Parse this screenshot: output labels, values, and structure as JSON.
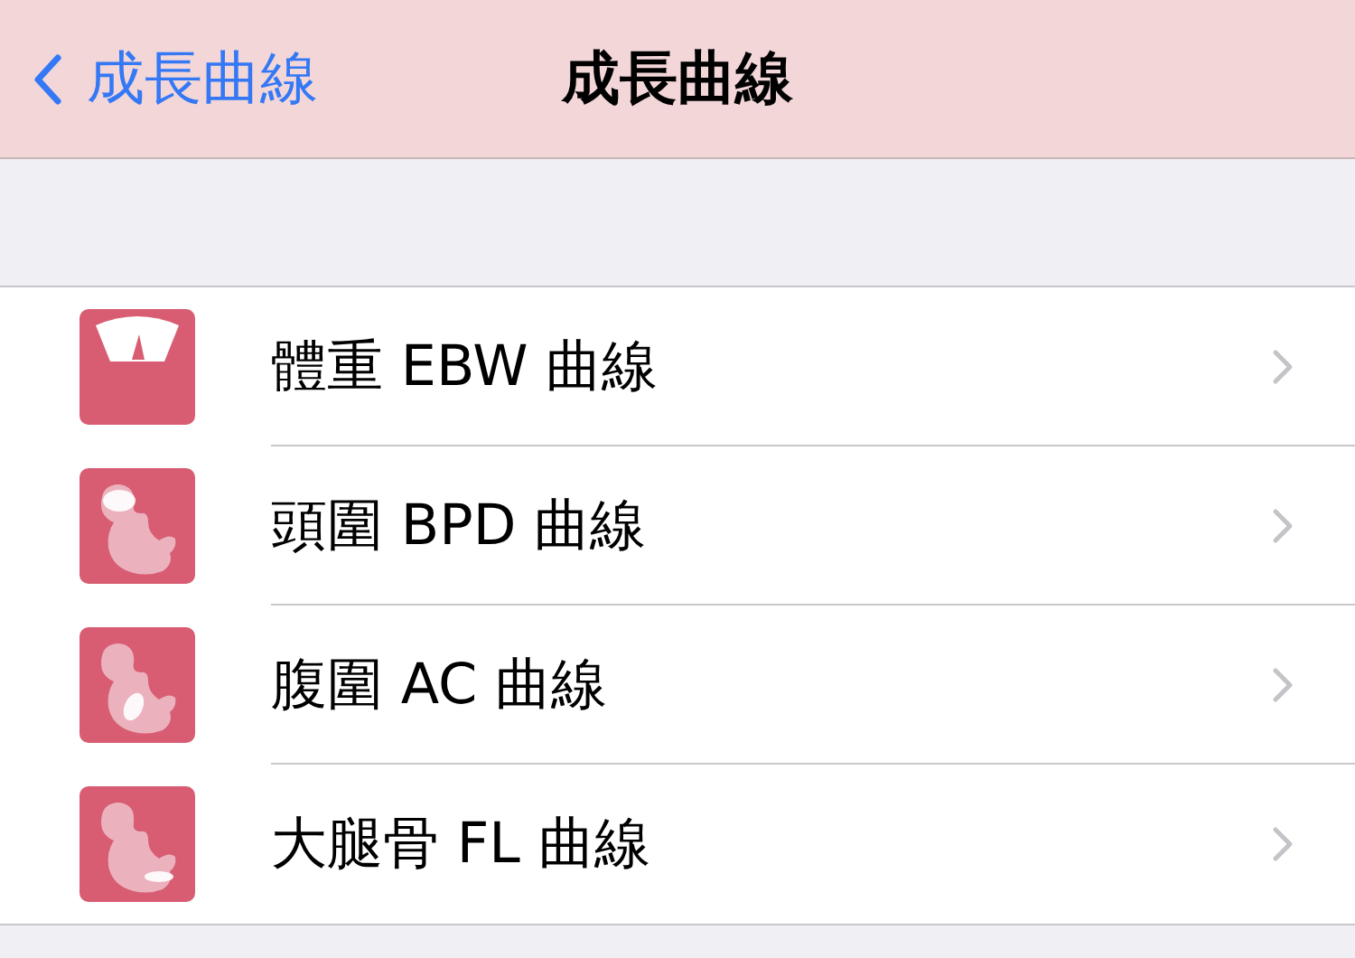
{
  "nav": {
    "back_label": "成長曲線",
    "title": "成長曲線"
  },
  "items": [
    {
      "kind": "scale",
      "label": "體重 EBW 曲線"
    },
    {
      "kind": "head",
      "label": "頭圍 BPD 曲線"
    },
    {
      "kind": "abdomen",
      "label": "腹圍 AC 曲線"
    },
    {
      "kind": "femur",
      "label": "大腿骨 FL 曲線"
    }
  ]
}
